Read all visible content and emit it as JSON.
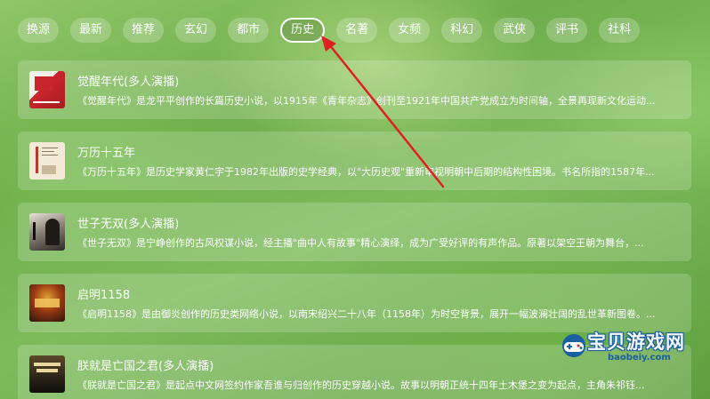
{
  "tabs": [
    {
      "label": "换源"
    },
    {
      "label": "最新"
    },
    {
      "label": "推荐"
    },
    {
      "label": "玄幻"
    },
    {
      "label": "都市"
    },
    {
      "label": "历史",
      "active": true
    },
    {
      "label": "名著"
    },
    {
      "label": "女频"
    },
    {
      "label": "科幻"
    },
    {
      "label": "武侠"
    },
    {
      "label": "评书"
    },
    {
      "label": "社科"
    }
  ],
  "books": [
    {
      "title": "觉醒年代(多人演播)",
      "desc": "《觉醒年代》是龙平平创作的长篇历史小说，以1915年《青年杂志》创刊至1921年中国共产党成立为时间轴，全景再现新文化运动...",
      "cover_color": "#c8262c"
    },
    {
      "title": "万历十五年",
      "desc": "《万历十五年》是历史学家黄仁宇于1982年出版的史学经典，以\"大历史观\"重新审视明朝中后期的结构性困境。书名所指的1587年...",
      "cover_color": "#efe6cf"
    },
    {
      "title": "世子无双(多人演播)",
      "desc": "《世子无双》是宁峥创作的古风权谋小说，经主播\"曲中人有故事\"精心演绎，成为广受好评的有声作品。原著以架空王朝为舞台，...",
      "cover_color": "#3d3a36"
    },
    {
      "title": "启明1158",
      "desc": "《启明1158》是由御炎创作的历史类网络小说，以南宋绍兴二十八年（1158年）为时空背景，展开一幅波澜壮阔的乱世革新图卷。...",
      "cover_color": "#3a1c10"
    },
    {
      "title": "朕就是亡国之君(多人演播)",
      "desc": "《朕就是亡国之君》是起点中文网签约作家吾谁与归创作的历史穿越小说。故事以明朝正统十四年土木堡之变为起点，主角朱祁钰...",
      "cover_color": "#2a2418"
    }
  ],
  "watermark": {
    "text": "宝贝游戏网",
    "url": "baobeiy.com"
  },
  "colors": {
    "accent_arrow": "#e02020",
    "text": "#ffffff"
  }
}
